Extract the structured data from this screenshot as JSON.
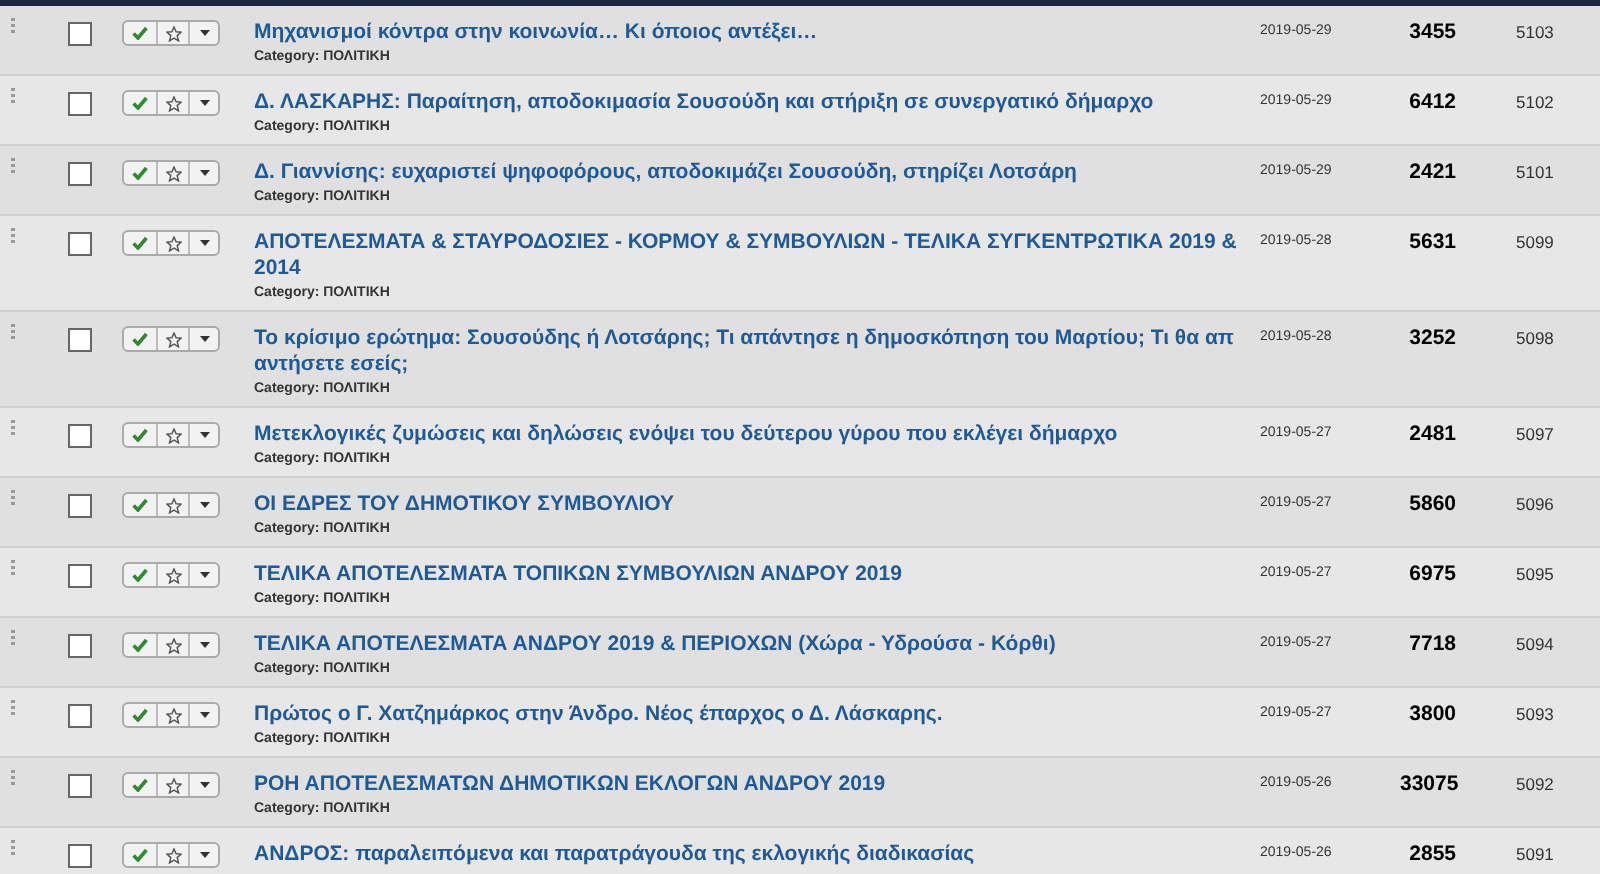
{
  "rows": [
    {
      "title": "Μηχανισμοί κόντρα στην κοινωνία… Κι όποιος αντέξει…",
      "category": "Category: ΠΟΛΙΤΙΚΗ",
      "date": "2019-05-29",
      "hits": "3455",
      "id": "5103",
      "checked": false,
      "published": true,
      "featured": false
    },
    {
      "title": "Δ. ΛΑΣΚΑΡΗΣ: Παραίτηση, αποδοκιμασία Σουσούδη και στήριξη σε συνεργατικό δήμαρχο",
      "category": "Category: ΠΟΛΙΤΙΚΗ",
      "date": "2019-05-29",
      "hits": "6412",
      "id": "5102",
      "checked": false,
      "published": true,
      "featured": false
    },
    {
      "title": "Δ. Γιαννίσης: ευχαριστεί ψηφοφόρους, αποδοκιμάζει Σουσούδη, στηρίζει Λοτσάρη",
      "category": "Category: ΠΟΛΙΤΙΚΗ",
      "date": "2019-05-29",
      "hits": "2421",
      "id": "5101",
      "checked": false,
      "published": true,
      "featured": false
    },
    {
      "title": "ΑΠΟΤΕΛΕΣΜΑΤΑ & ΣΤΑΥΡΟΔΟΣΙΕΣ - ΚΟΡΜΟΥ & ΣΥΜΒΟΥΛΙΩΝ - ΤΕΛΙΚΑ ΣΥΓΚΕΝΤΡΩΤΙΚΑ 2019 & 2014",
      "category": "Category: ΠΟΛΙΤΙΚΗ",
      "date": "2019-05-28",
      "hits": "5631",
      "id": "5099",
      "checked": false,
      "published": true,
      "featured": false
    },
    {
      "title": "Το κρίσιμο ερώτημα: Σουσούδης ή Λοτσάρης; Τι απάντησε η δημοσκόπηση του Μαρτίου; Τι θα απαντήσετε εσείς;",
      "category": "Category: ΠΟΛΙΤΙΚΗ",
      "date": "2019-05-28",
      "hits": "3252",
      "id": "5098",
      "checked": false,
      "published": true,
      "featured": false
    },
    {
      "title": "Μετεκλογικές ζυμώσεις και δηλώσεις ενόψει του δεύτερου γύρου που εκλέγει δήμαρχο",
      "category": "Category: ΠΟΛΙΤΙΚΗ",
      "date": "2019-05-27",
      "hits": "2481",
      "id": "5097",
      "checked": false,
      "published": true,
      "featured": false
    },
    {
      "title": "ΟΙ ΕΔΡΕΣ ΤΟΥ ΔΗΜΟΤΙΚΟΥ ΣΥΜΒΟΥΛΙΟΥ",
      "category": "Category: ΠΟΛΙΤΙΚΗ",
      "date": "2019-05-27",
      "hits": "5860",
      "id": "5096",
      "checked": false,
      "published": true,
      "featured": false
    },
    {
      "title": "ΤΕΛΙΚΑ ΑΠΟΤΕΛΕΣΜΑΤΑ ΤΟΠΙΚΩΝ ΣΥΜΒΟΥΛΙΩΝ ΑΝΔΡΟΥ 2019",
      "category": "Category: ΠΟΛΙΤΙΚΗ",
      "date": "2019-05-27",
      "hits": "6975",
      "id": "5095",
      "checked": false,
      "published": true,
      "featured": false
    },
    {
      "title": "ΤΕΛΙΚΑ ΑΠΟΤΕΛΕΣΜΑΤΑ ΑΝΔΡΟΥ 2019 & ΠΕΡΙΟΧΩΝ (Χώρα - Υδρούσα - Κόρθι)",
      "category": "Category: ΠΟΛΙΤΙΚΗ",
      "date": "2019-05-27",
      "hits": "7718",
      "id": "5094",
      "checked": false,
      "published": true,
      "featured": false
    },
    {
      "title": "Πρώτος ο Γ. Χατζημάρκος στην Άνδρο. Νέος έπαρχος ο Δ. Λάσκαρης.",
      "category": "Category: ΠΟΛΙΤΙΚΗ",
      "date": "2019-05-27",
      "hits": "3800",
      "id": "5093",
      "checked": false,
      "published": true,
      "featured": false
    },
    {
      "title": "ΡΟΗ ΑΠΟΤΕΛΕΣΜΑΤΩΝ ΔΗΜΟΤΙΚΩΝ ΕΚΛΟΓΩΝ ΑΝΔΡΟΥ 2019",
      "category": "Category: ΠΟΛΙΤΙΚΗ",
      "date": "2019-05-26",
      "hits": "33075",
      "id": "5092",
      "checked": false,
      "published": true,
      "featured": false
    },
    {
      "title": "ΑΝΔΡΟΣ: παραλειπόμενα και παρατράγουδα της εκλογικής διαδικασίας",
      "date": "2019-05-26",
      "hits": "2855",
      "id": "5091",
      "checked": false,
      "published": true,
      "featured": false
    }
  ]
}
